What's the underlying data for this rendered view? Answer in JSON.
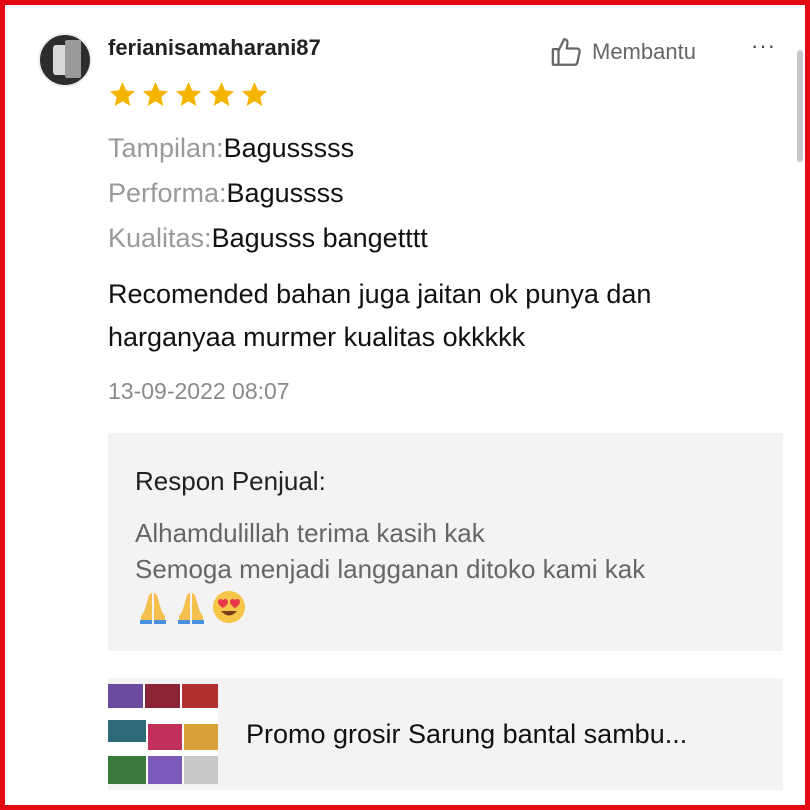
{
  "review": {
    "username": "ferianisamaharani87",
    "helpful_label": "Membantu",
    "more_label": "···",
    "rating": 5,
    "attributes": [
      {
        "key": "Tampilan:",
        "value": "Bagusssss"
      },
      {
        "key": "Performa:",
        "value": "Bagussss"
      },
      {
        "key": "Kualitas:",
        "value": "Bagusss bangetttt"
      }
    ],
    "comment": "Recomended bahan juga jaitan ok punya dan harganyaa murmer kualitas okkkkk",
    "timestamp": "13-09-2022 08:07"
  },
  "seller_response": {
    "title": "Respon Penjual:",
    "line1": "Alhamdulillah terima kasih kak",
    "line2": "Semoga menjadi langganan ditoko kami kak",
    "emojis": [
      "folded-hands-emoji",
      "folded-hands-emoji",
      "heart-eyes-emoji"
    ]
  },
  "product": {
    "name": "Promo grosir Sarung bantal sambu..."
  },
  "colors": {
    "border": "#e50914",
    "star": "#f5b400",
    "muted": "#9a9a9a",
    "panel": "#f3f3f3"
  }
}
